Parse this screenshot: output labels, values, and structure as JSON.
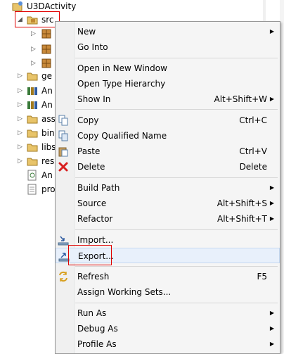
{
  "tree": {
    "root": "U3DActivity",
    "selected": "src",
    "items": [
      "ge",
      "An",
      "An",
      "ass",
      "bin",
      "libs",
      "res",
      "An",
      "pro"
    ]
  },
  "menu": {
    "new": "New",
    "go_into": "Go Into",
    "open_new_window": "Open in New Window",
    "open_type_hierarchy": "Open Type Hierarchy",
    "show_in": "Show In",
    "show_in_sc": "Alt+Shift+W",
    "copy": "Copy",
    "copy_sc": "Ctrl+C",
    "copy_qualified": "Copy Qualified Name",
    "paste": "Paste",
    "paste_sc": "Ctrl+V",
    "delete": "Delete",
    "delete_sc": "Delete",
    "build_path": "Build Path",
    "source": "Source",
    "source_sc": "Alt+Shift+S",
    "refactor": "Refactor",
    "refactor_sc": "Alt+Shift+T",
    "import": "Import...",
    "export": "Export...",
    "refresh": "Refresh",
    "refresh_sc": "F5",
    "assign_working_sets": "Assign Working Sets...",
    "run_as": "Run As",
    "debug_as": "Debug As",
    "profile_as": "Profile As"
  },
  "colors": {
    "highlight_box": "#e00000",
    "delete_icon": "#d81e1e"
  }
}
